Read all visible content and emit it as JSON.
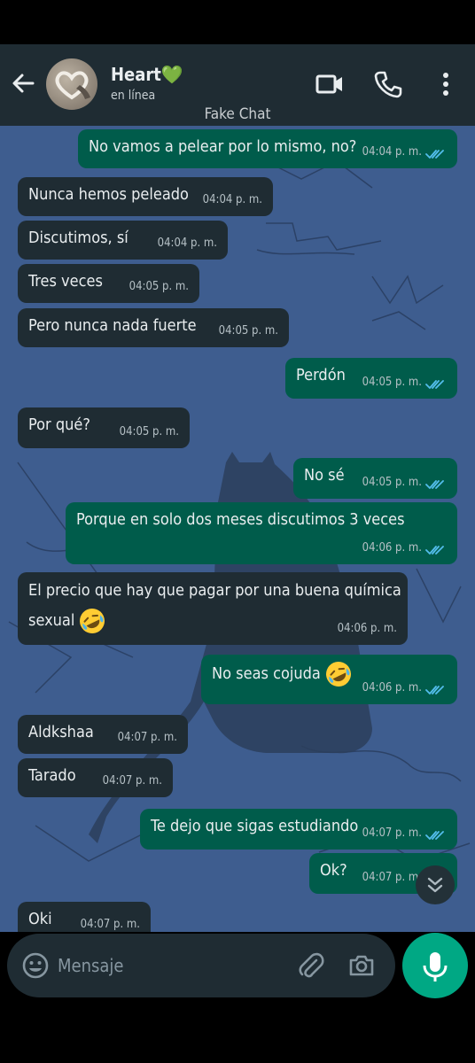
{
  "header": {
    "contact_name": "Heart💚",
    "status": "en línea"
  },
  "watermark": "Fake Chat",
  "messages": [
    {
      "dir": "out",
      "text": "No vamos a pelear por lo mismo, no?",
      "time": "04:04 p. m.",
      "read": true
    },
    {
      "dir": "in",
      "text": "Nunca hemos peleado",
      "time": "04:04 p. m."
    },
    {
      "dir": "in",
      "text": "Discutimos, sí",
      "time": "04:04 p. m."
    },
    {
      "dir": "in",
      "text": "Tres veces",
      "time": "04:05 p. m."
    },
    {
      "dir": "in",
      "text": "Pero nunca nada fuerte",
      "time": "04:05 p. m."
    },
    {
      "dir": "out",
      "text": "Perdón",
      "time": "04:05 p. m.",
      "read": true
    },
    {
      "dir": "in",
      "text": "Por qué?",
      "time": "04:05 p. m."
    },
    {
      "dir": "out",
      "text": "No sé",
      "time": "04:05 p. m.",
      "read": true
    },
    {
      "dir": "out",
      "text": "Porque en solo dos meses discutimos 3 veces",
      "time": "04:06 p. m.",
      "read": true
    },
    {
      "dir": "in",
      "text_line1": "El precio que hay que pagar por una buena química",
      "text_line2": "sexual",
      "emoji": "rolling-on-the-floor-laughing-emoji",
      "time": "04:06 p. m."
    },
    {
      "dir": "out",
      "text": "No seas cojuda",
      "emoji": "rolling-on-the-floor-laughing-emoji",
      "time": "04:06 p. m.",
      "read": true
    },
    {
      "dir": "in",
      "text": "Aldkshaa",
      "time": "04:07 p. m."
    },
    {
      "dir": "in",
      "text": "Tarado",
      "time": "04:07 p. m."
    },
    {
      "dir": "out",
      "text": "Te dejo que sigas estudiando",
      "time": "04:07 p. m.",
      "read": true
    },
    {
      "dir": "out",
      "text": "Ok?",
      "time": "04:07 p. m.",
      "read": true
    },
    {
      "dir": "in",
      "text": "Oki",
      "time": "04:07 p. m."
    }
  ],
  "input": {
    "placeholder": "Mensaje"
  },
  "colors": {
    "header_bg": "#1f2c33",
    "incoming_bubble": "#1f2c33",
    "outgoing_bubble": "#005c4b",
    "read_ticks": "#53bdeb",
    "mic_button": "#00a884",
    "wallpaper": "#3e5d8f"
  },
  "icons": [
    "back-arrow-icon",
    "video-call-icon",
    "phone-icon",
    "more-options-icon",
    "emoji-icon",
    "attach-icon",
    "camera-icon",
    "microphone-icon",
    "scroll-down-icon"
  ]
}
